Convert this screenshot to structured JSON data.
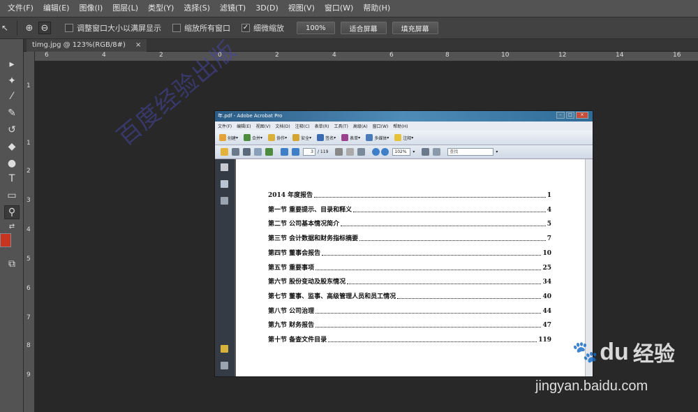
{
  "menubar": {
    "items": [
      "文件(F)",
      "编辑(E)",
      "图像(I)",
      "图层(L)",
      "类型(Y)",
      "选择(S)",
      "滤镜(T)",
      "3D(D)",
      "视图(V)",
      "窗口(W)",
      "帮助(H)"
    ]
  },
  "options": {
    "tool_glyph": "↖",
    "zoom_in_icon": "zoom-in-icon",
    "zoom_out_icon": "zoom-out-icon",
    "resize_windows_label": "调整窗口大小以满屏显示",
    "resize_windows_checked": false,
    "zoom_all_windows_label": "缩放所有窗口",
    "zoom_all_windows_checked": false,
    "scrubby_zoom_label": "细微缩放",
    "scrubby_zoom_checked": true,
    "btn_100": "100%",
    "btn_fit": "适合屏幕",
    "btn_fill": "填充屏幕"
  },
  "document": {
    "tab_title": "timg.jpg @ 123%(RGB/8#)",
    "tab_close": "×"
  },
  "ruler": {
    "h_ticks": [
      "6",
      "4",
      "2",
      "0",
      "2",
      "4",
      "6",
      "8",
      "10",
      "12",
      "14",
      "16"
    ],
    "v_ticks": [
      "1",
      "1",
      "2",
      "3",
      "4",
      "5",
      "6",
      "7",
      "8",
      "9"
    ]
  },
  "tools": [
    {
      "name": "move-tool",
      "glyph": "▸"
    },
    {
      "name": "magic-wand-tool",
      "glyph": "✦"
    },
    {
      "name": "eyedropper-tool",
      "glyph": "⁄"
    },
    {
      "name": "brush-tool",
      "glyph": "✎"
    },
    {
      "name": "history-brush-tool",
      "glyph": "↺"
    },
    {
      "name": "paint-bucket-tool",
      "glyph": "◆"
    },
    {
      "name": "dodge-tool",
      "glyph": "●"
    },
    {
      "name": "type-tool",
      "glyph": "T"
    },
    {
      "name": "rectangle-tool",
      "glyph": "▭"
    },
    {
      "name": "zoom-tool",
      "glyph": "⚲"
    },
    {
      "name": "screen-mode-tool",
      "glyph": "⧉"
    }
  ],
  "colors": {
    "foreground": "#c8341f"
  },
  "acrobat": {
    "window_title": "年.pdf - Adobe Acrobat Pro",
    "menu": [
      "文件(F)",
      "编辑(E)",
      "视图(V)",
      "文档(D)",
      "注释(C)",
      "表单(R)",
      "工具(T)",
      "高级(A)",
      "窗口(W)",
      "帮助(H)"
    ],
    "toolbar1": [
      {
        "label": "创建",
        "color": "#e3a23a"
      },
      {
        "label": "合并",
        "color": "#4d8b3f"
      },
      {
        "label": "协作",
        "color": "#d9b13a"
      },
      {
        "label": "安全",
        "color": "#d5a532"
      },
      {
        "label": "签名",
        "color": "#3a6ab0"
      },
      {
        "label": "表单",
        "color": "#9b3f8f"
      },
      {
        "label": "多媒体",
        "color": "#4a7ab8"
      },
      {
        "label": "注释",
        "color": "#e6c23a"
      }
    ],
    "page_current": "3",
    "page_total": "/ 119",
    "zoom": "102%",
    "search_placeholder": "查找",
    "toc": [
      {
        "title": "2014 年度报告",
        "page": "1"
      },
      {
        "title": "第一节  重要提示、目录和释义",
        "page": "4"
      },
      {
        "title": "第二节  公司基本情况简介",
        "page": "5"
      },
      {
        "title": "第三节  会计数据和财务指标摘要",
        "page": "7"
      },
      {
        "title": "第四节  董事会报告",
        "page": "10"
      },
      {
        "title": "第五节  重要事项",
        "page": "25"
      },
      {
        "title": "第六节  股份变动及股东情况",
        "page": "34"
      },
      {
        "title": "第七节  董事、监事、高级管理人员和员工情况",
        "page": "40"
      },
      {
        "title": "第八节  公司治理",
        "page": "44"
      },
      {
        "title": "第九节  财务报告",
        "page": "47"
      },
      {
        "title": "第十节  备查文件目录",
        "page": "119"
      }
    ],
    "watermark": "百度经验出版"
  },
  "watermark_baidu": {
    "logo_prefix": "Bai",
    "logo_suffix": "du",
    "logo_cn": "经验",
    "site": "jingyan.baidu.com"
  }
}
